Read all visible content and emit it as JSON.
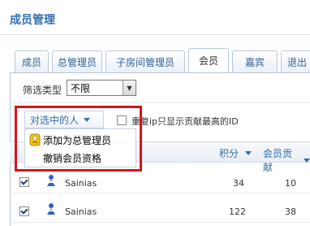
{
  "page": {
    "title": "成员管理"
  },
  "tabs": [
    {
      "label": "成员",
      "active": false
    },
    {
      "label": "总管理员",
      "active": false
    },
    {
      "label": "子房间管理员",
      "active": false
    },
    {
      "label": "会员",
      "active": true
    },
    {
      "label": "嘉宾",
      "active": false
    },
    {
      "label": "退出",
      "active": false
    }
  ],
  "filter": {
    "label": "筛选类型",
    "select_value": "不限"
  },
  "batch_dropdown": {
    "label": "对选中的人",
    "items": [
      {
        "label": "添加为总管理员",
        "icon": "admin-badge-icon"
      },
      {
        "label": "撤销会员资格",
        "icon": ""
      }
    ]
  },
  "dedupe_option": {
    "label": "重复ip只显示贡献最高的ID"
  },
  "table": {
    "columns": [
      {
        "label": "积分"
      },
      {
        "label": "会员贡献"
      }
    ],
    "rows": [
      {
        "name": "Sainias",
        "points": "34",
        "contribution": "10",
        "checked": true
      },
      {
        "name": "Sainias",
        "points": "122",
        "contribution": "38",
        "checked": true
      }
    ]
  },
  "colors": {
    "accent": "#2f6fb0",
    "highlight": "#d6141c",
    "tab_border": "#b9c6d6"
  }
}
